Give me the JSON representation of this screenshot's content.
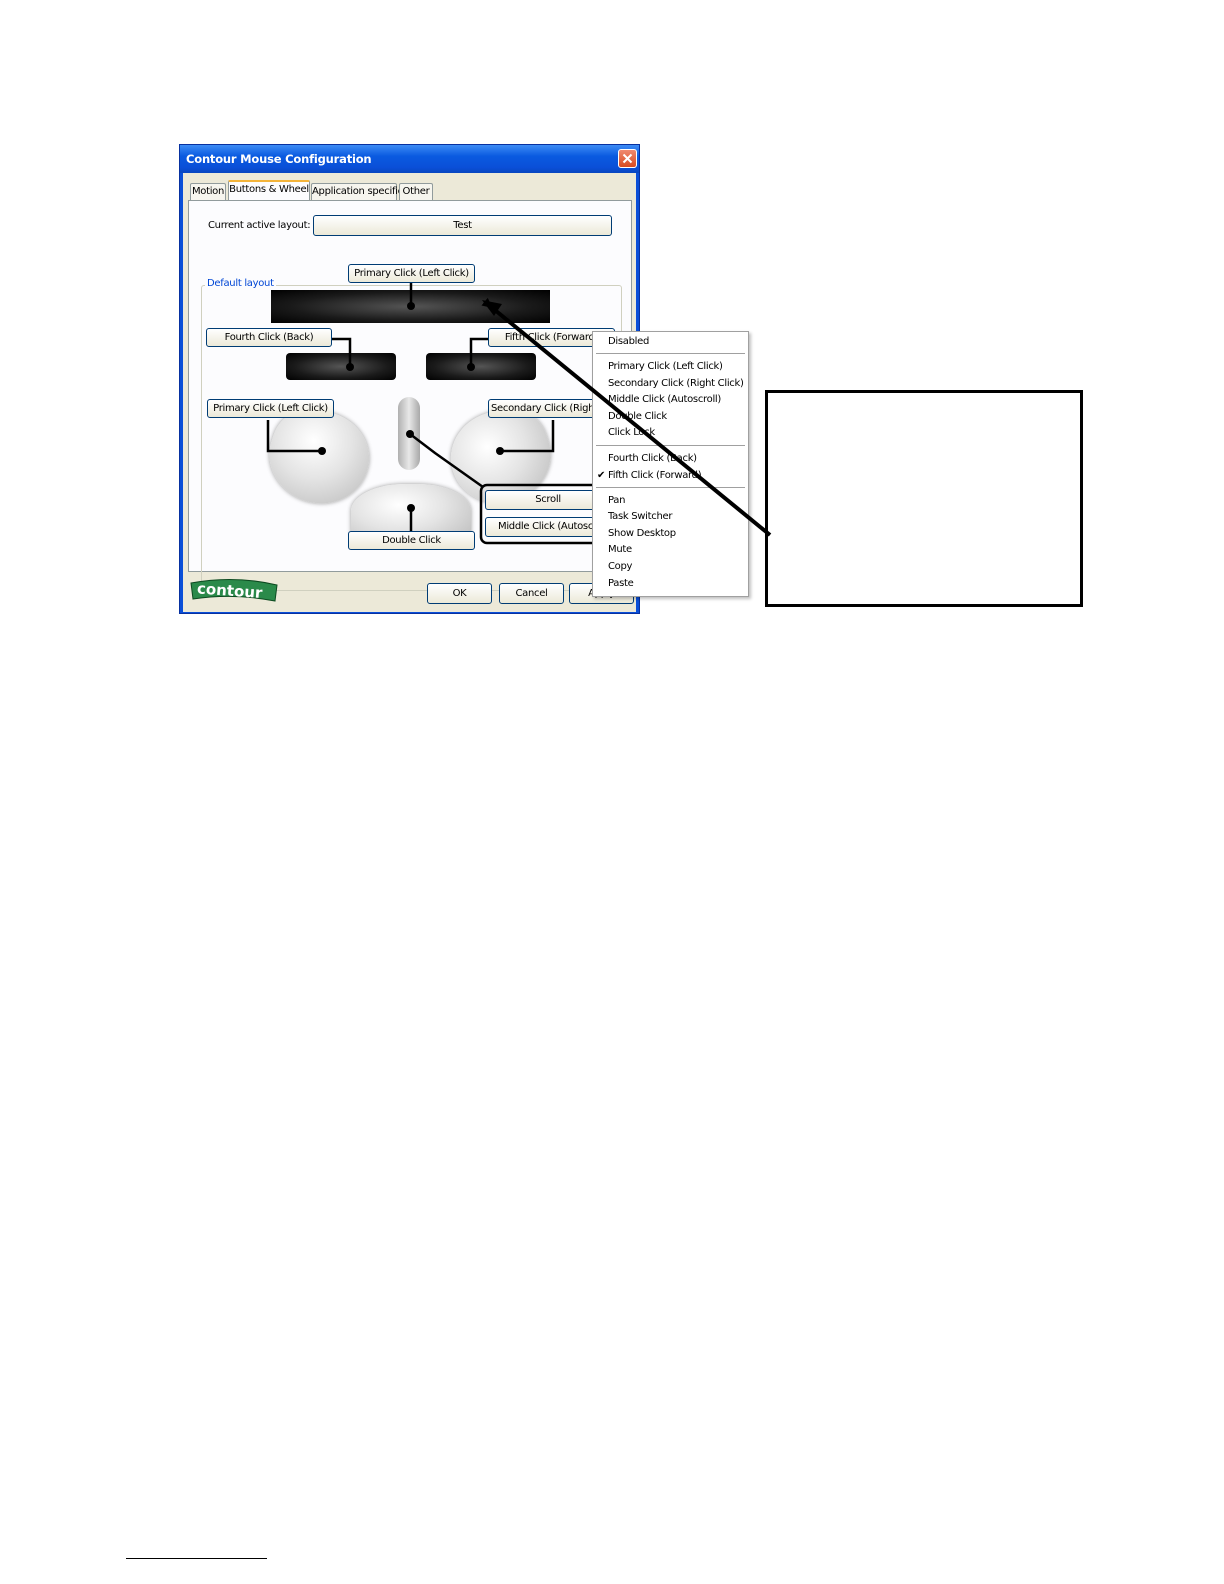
{
  "window": {
    "title": "Contour Mouse Configuration",
    "close_icon": "close-icon"
  },
  "tabs": [
    {
      "label": "Motion",
      "active": false
    },
    {
      "label": "Buttons & Wheel",
      "active": true
    },
    {
      "label": "Application specific",
      "active": false
    },
    {
      "label": "Other",
      "active": false
    }
  ],
  "layout": {
    "current_label": "Current active layout:",
    "current_value": "Test",
    "group_title": "Default layout"
  },
  "mouse_buttons": {
    "top": "Primary Click (Left Click)",
    "fourth": "Fourth Click (Back)",
    "fifth": "Fifth Click (Forward)",
    "left": "Primary Click (Left Click)",
    "right": "Secondary Click (Right C",
    "scroll": "Scroll",
    "middle": "Middle Click (Autoscroll",
    "bottom": "Double Click"
  },
  "footer": {
    "logo_text": "contour",
    "ok": "OK",
    "cancel": "Cancel",
    "apply": "Apply"
  },
  "context_menu": {
    "items": [
      "Disabled",
      "Primary Click (Left Click)",
      "Secondary Click (Right Click)",
      "Middle Click (Autoscroll)",
      "Double Click",
      "Click Lock",
      "Fourth Click (Back)",
      "Fifth Click (Forward)",
      "Pan",
      "Task Switcher",
      "Show Desktop",
      "Mute",
      "Copy",
      "Paste"
    ],
    "checked_item": "Fifth Click (Forward)",
    "check_icon": "checkmark-icon"
  }
}
